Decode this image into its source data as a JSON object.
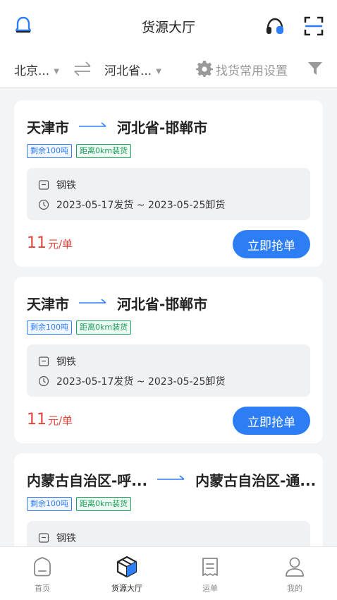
{
  "header": {
    "title": "货源大厅"
  },
  "filter": {
    "origin": "北京...",
    "destination": "河北省...",
    "settings_label": "找货常用设置"
  },
  "cards": [
    {
      "from": "天津市",
      "to": "河北省-邯郸市",
      "tag_remaining": "剩余100吨",
      "tag_distance": "距离0km装货",
      "cargo": "钢铁",
      "schedule": "2023-05-17发货 ~ 2023-05-25卸货",
      "price": "11",
      "price_unit": "元/单",
      "button": "立即抢单"
    },
    {
      "from": "天津市",
      "to": "河北省-邯郸市",
      "tag_remaining": "剩余100吨",
      "tag_distance": "距离0km装货",
      "cargo": "钢铁",
      "schedule": "2023-05-17发货 ~ 2023-05-25卸货",
      "price": "11",
      "price_unit": "元/单",
      "button": "立即抢单"
    },
    {
      "from": "内蒙古自治区-呼...",
      "to": "内蒙古自治区-通...",
      "tag_remaining": "剩余100吨",
      "tag_distance": "距离0km装货",
      "cargo": "钢铁"
    }
  ],
  "tabbar": {
    "items": [
      {
        "label": "首页",
        "icon": "home-icon"
      },
      {
        "label": "货源大厅",
        "icon": "cargo-box-icon"
      },
      {
        "label": "运单",
        "icon": "waybill-icon"
      },
      {
        "label": "我的",
        "icon": "profile-icon"
      }
    ],
    "active_index": 1
  },
  "colors": {
    "accent": "#2d7ef5",
    "price": "#e0443a",
    "tag_blue": "#2f7cf6",
    "tag_green": "#1aa15a"
  }
}
